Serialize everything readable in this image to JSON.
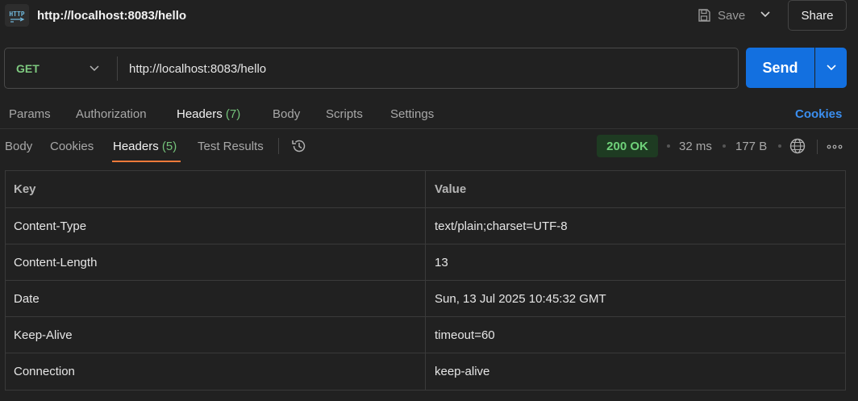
{
  "titlebar": {
    "badge_text": "HTTP",
    "title": "http://localhost:8083/hello",
    "save_label": "Save",
    "share_label": "Share"
  },
  "request": {
    "method": "GET",
    "url": "http://localhost:8083/hello",
    "send_label": "Send"
  },
  "request_tabs": {
    "params": "Params",
    "authorization": "Authorization",
    "headers": "Headers",
    "headers_count": "(7)",
    "body": "Body",
    "scripts": "Scripts",
    "settings": "Settings",
    "cookies": "Cookies"
  },
  "response_tabs": {
    "body": "Body",
    "cookies": "Cookies",
    "headers": "Headers",
    "headers_count": "(5)",
    "test_results": "Test Results"
  },
  "response_meta": {
    "status": "200 OK",
    "time": "32 ms",
    "size": "177 B"
  },
  "headers_table": {
    "columns": [
      "Key",
      "Value"
    ],
    "rows": [
      {
        "key": "Content-Type",
        "value": "text/plain;charset=UTF-8"
      },
      {
        "key": "Content-Length",
        "value": "13"
      },
      {
        "key": "Date",
        "value": "Sun, 13 Jul 2025 10:45:32 GMT"
      },
      {
        "key": "Keep-Alive",
        "value": "timeout=60"
      },
      {
        "key": "Connection",
        "value": "keep-alive"
      }
    ]
  },
  "colors": {
    "accent_blue": "#1370e0",
    "status_green": "#6fd27a",
    "tab_underline": "#f07a3a"
  },
  "icons": [
    "http-icon",
    "save-icon",
    "chevron-down-icon",
    "history-icon",
    "globe-icon",
    "more-horizontal-icon"
  ]
}
